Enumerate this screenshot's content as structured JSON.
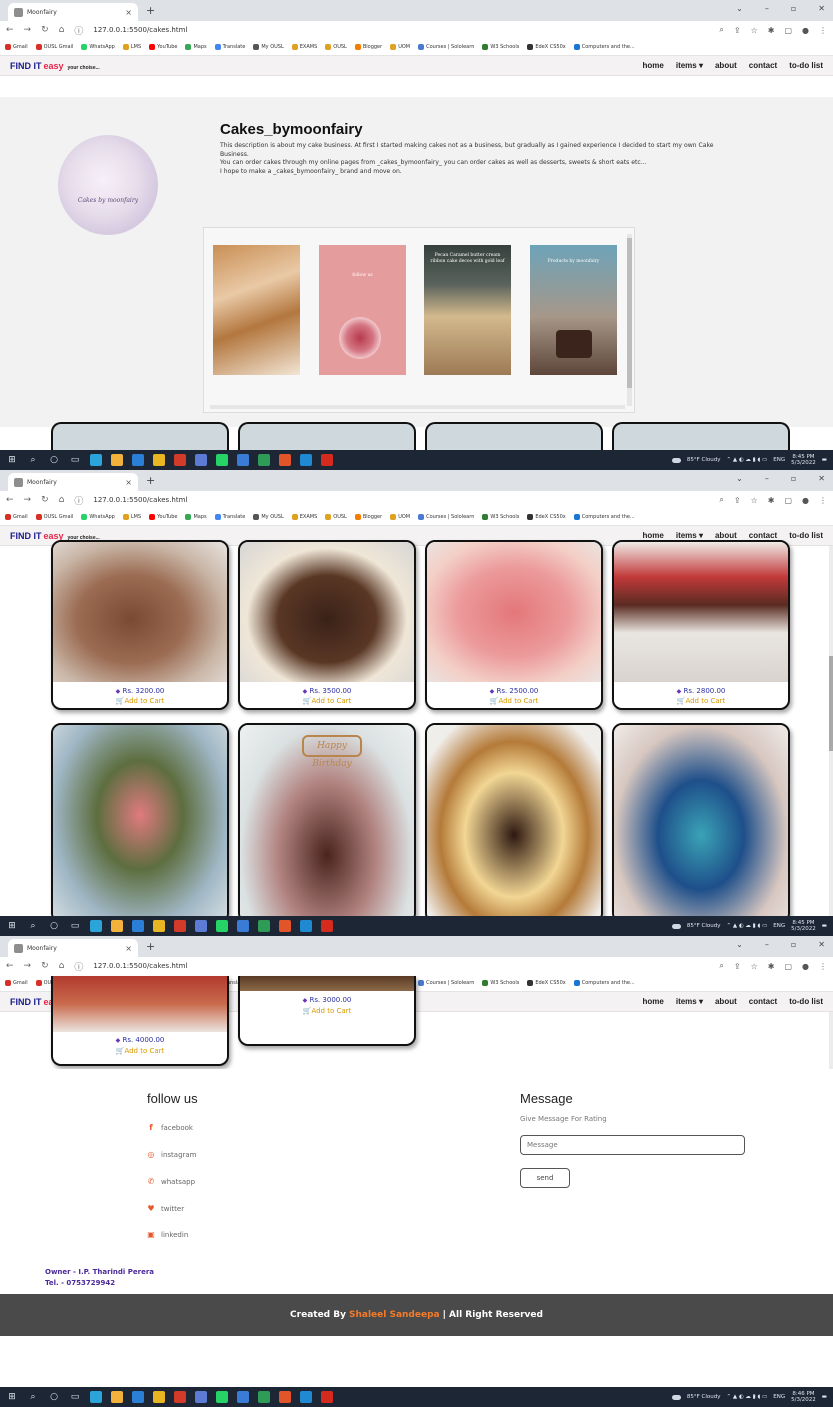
{
  "browser": {
    "tab_title": "Moonfairy",
    "tab_close": "×",
    "new_tab": "+",
    "url": "127.0.0.1:5500/cakes.html",
    "bookmarks": [
      "Gmail",
      "OUSL Gmail",
      "WhatsApp",
      "LMS",
      "YouTube",
      "Maps",
      "Translate",
      "My OUSL",
      "EXAMS",
      "OUSL",
      "Blogger",
      "UOM",
      "Courses | Sololearn",
      "W3 Schools",
      "EdeX CS50x",
      "Computers and the..."
    ],
    "bookmark_colors": [
      "#d93025",
      "#d93025",
      "#25d366",
      "#e0a020",
      "#ff0000",
      "#34a853",
      "#4285f4",
      "#555555",
      "#e0a020",
      "#e0a020",
      "#f57c00",
      "#e0a020",
      "#4a7bd0",
      "#2e7d32",
      "#333333",
      "#1976d2"
    ]
  },
  "site": {
    "brand_find": "FIND IT",
    "brand_easy": "easy",
    "brand_tag": "your choise...",
    "nav": [
      "home",
      "items ▾",
      "about",
      "contact",
      "to-do list"
    ]
  },
  "hero": {
    "logo_text": "Cakes by moonfairy",
    "title": "Cakes_bymoonfairy",
    "desc1": "This description is about my cake business. At first I started making cakes not as a business, but gradually as I gained experience I decided to start my own Cake Business.",
    "desc2": "You can order cakes through my online pages from _cakes_bymoonfairy_ you can order cakes as well as desserts, sweets & short eats etc...",
    "desc3": "I hope to make a _cakes_bymoonfairy_ brand and move on.",
    "gallery_caption_3": "Pecan Caramel butter cream ribbon cake decos with gold leaf",
    "gallery_caption_4": "Products by moonfairy",
    "gallery_caption_2": "follow us"
  },
  "cards": [
    {
      "price": "Rs. 3200.00",
      "cart": "Add to Cart"
    },
    {
      "price": "Rs. 3500.00",
      "cart": "Add to Cart"
    },
    {
      "price": "Rs. 2500.00",
      "cart": "Add to Cart"
    },
    {
      "price": "Rs. 2800.00",
      "cart": "Add to Cart"
    },
    {
      "price": "Rs. 4000.00",
      "cart": "Add to Cart"
    },
    {
      "price": "Rs. 3000.00",
      "cart": "Add to Cart"
    }
  ],
  "topper_text": "Happy Birthday",
  "footer": {
    "follow_title": "follow us",
    "social": [
      "facebook",
      "instagram",
      "whatsapp",
      "twitter",
      "linkedin"
    ],
    "social_colors": [
      "#e8572a",
      "#e8572a",
      "#e8572a",
      "#e8572a",
      "#e8572a"
    ],
    "message_title": "Message",
    "message_sub": "Give Message For Rating",
    "message_placeholder": "Message",
    "send_label": "send",
    "owner": "Owner - I.P. Tharindi Perera",
    "tel": "Tel. - 0753729942",
    "created_by": "Created By",
    "creator": "Shaleel Sandeepa",
    "rights": "| All Right Reserved"
  },
  "taskbar": {
    "weather": "85°F Cloudy",
    "lang": "ENG",
    "time_1": "8:45 PM",
    "time_2": "8:45 PM",
    "time_3": "8:46 PM",
    "date": "5/3/2022"
  }
}
